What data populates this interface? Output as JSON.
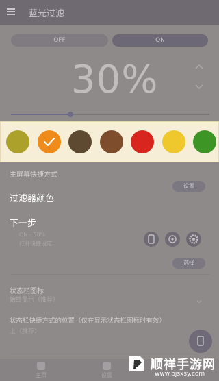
{
  "app": {
    "title": "蓝光过滤"
  },
  "toggle": {
    "off_label": "OFF",
    "on_label": "ON"
  },
  "filter": {
    "percent_text": "30%",
    "level_fraction": 0.3
  },
  "palette": {
    "title": "过滤器颜色",
    "selected_index": 1,
    "swatches": [
      {
        "name": "olive",
        "color": "#aca22b"
      },
      {
        "name": "orange",
        "color": "#ef8b1a"
      },
      {
        "name": "dark-brown",
        "color": "#5e4a30"
      },
      {
        "name": "brown",
        "color": "#7e4d2c"
      },
      {
        "name": "red",
        "color": "#d8261e"
      },
      {
        "name": "yellow",
        "color": "#efc82d"
      },
      {
        "name": "green",
        "color": "#3c9524"
      }
    ]
  },
  "sections": {
    "shortcut_title": "主屏幕快捷方式",
    "shortcut_button": "设置",
    "next_step": "下一步",
    "status_line": "ON - 50%",
    "status_sub": "打开快捷设定",
    "select_button": "选择",
    "statusbar_icon_title": "状态栏图标",
    "statusbar_icon_value": "始终显示（推荐）",
    "statusbar_pos_title": "状态栏快捷方式的位置（仅在显示状态栏图标时有效）",
    "statusbar_pos_value": "上（推荐）"
  },
  "nav": {
    "items": [
      "主页",
      "设置"
    ]
  },
  "watermark": {
    "brand": "顺祥手游网",
    "url": "www.bjsxsy.com"
  },
  "colors": {
    "accent": "#6d6a86",
    "palette_bg": "#f7eed7"
  }
}
